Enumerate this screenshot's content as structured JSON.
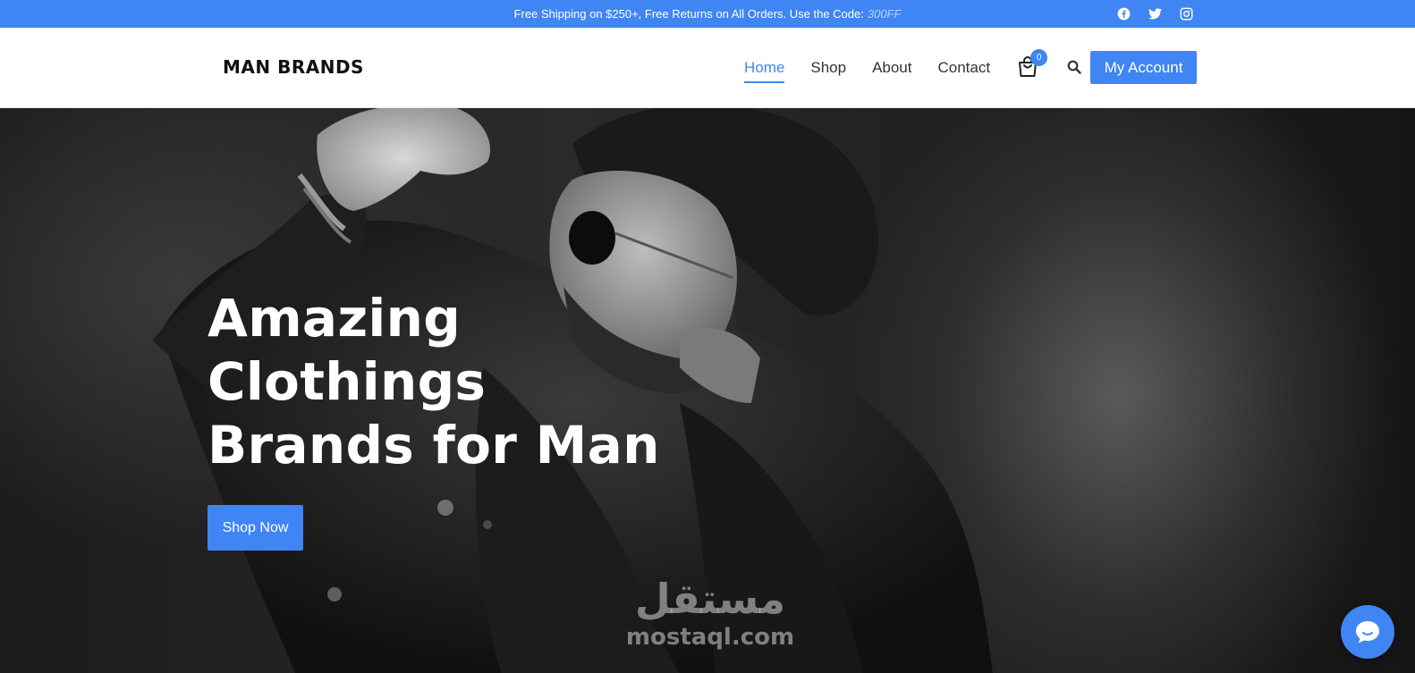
{
  "topbar": {
    "message": "Free Shipping on $250+, Free Returns on All Orders. Use the Code:",
    "code": "300FF",
    "socials": [
      "facebook-icon",
      "twitter-icon",
      "instagram-icon"
    ]
  },
  "header": {
    "logo": "MAN BRANDS",
    "nav": [
      {
        "label": "Home",
        "active": true
      },
      {
        "label": "Shop",
        "active": false
      },
      {
        "label": "About",
        "active": false
      },
      {
        "label": "Contact",
        "active": false
      }
    ],
    "cart_count": "0",
    "account_label": "My Account"
  },
  "hero": {
    "line1": "Amazing",
    "line2": "Clothings",
    "line3": "Brands for Man",
    "cta_label": "Shop Now"
  },
  "watermark": {
    "arabic": "مستقل",
    "latin": "mostaql.com"
  },
  "colors": {
    "accent": "#3f86f4",
    "header_bg": "#ffffff",
    "text_dark": "#333333"
  }
}
